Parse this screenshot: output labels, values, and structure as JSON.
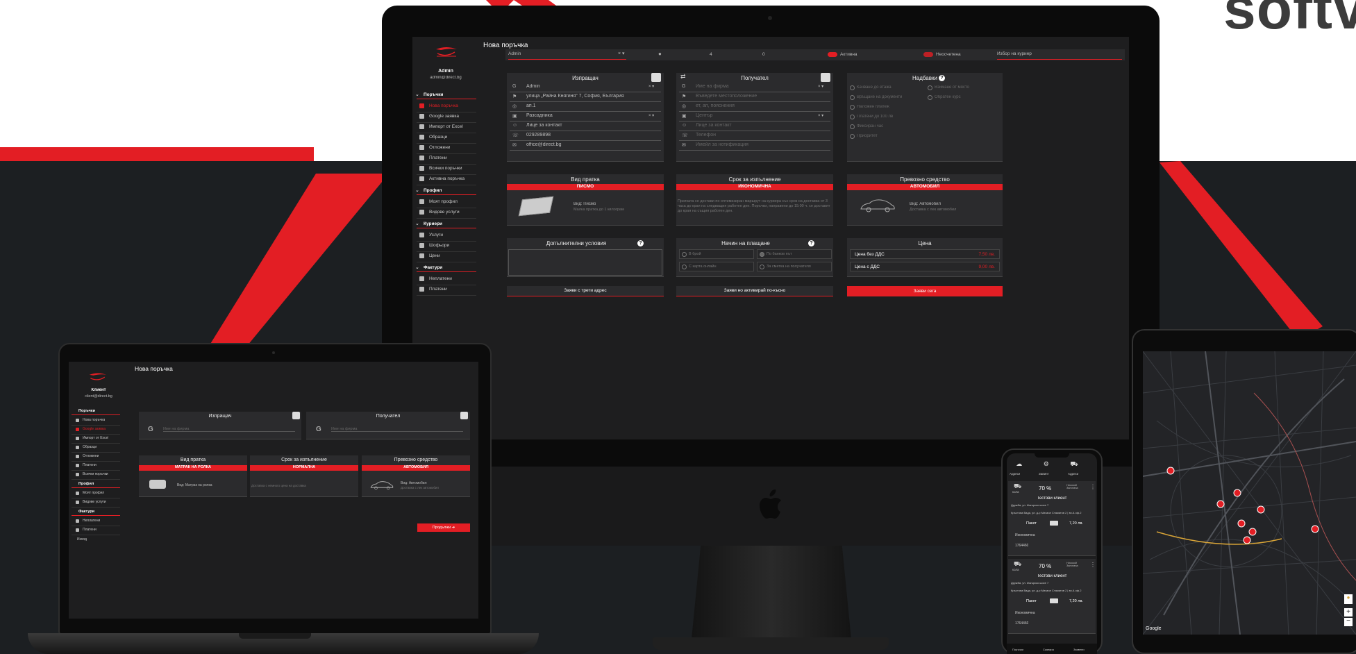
{
  "brand_text": "softv",
  "colors": {
    "accent": "#e31e24",
    "panel": "#1e1e1f",
    "card": "#2b2b2d",
    "dark_bg": "#1c1f22"
  },
  "monitor": {
    "page_title": "Нова поръчка",
    "user": {
      "name": "Admin",
      "email": "admin@direct.bg"
    },
    "nav": {
      "sections": [
        {
          "title": "Поръчки",
          "items": [
            "Нова поръчка",
            "Google заявка",
            "Импорт от Excel",
            "Образци",
            "Отложени",
            "Платени",
            "Всички поръчки",
            "Активна поръчка"
          ]
        },
        {
          "title": "Профил",
          "items": [
            "Моят профил",
            "Видове услуги"
          ]
        },
        {
          "title": "Куриери",
          "items": [
            "Услуги",
            "Шофьори",
            "Цени"
          ]
        },
        {
          "title": "Фактури",
          "items": [
            "Неплатени",
            "Платени"
          ]
        }
      ]
    },
    "topbar": {
      "client": "Admin",
      "count_a": "4",
      "count_b": "0",
      "toggle_active": "Активна",
      "toggle_unpaid": "Неосчетена",
      "courier_placeholder": "Избор на куриер"
    },
    "sender": {
      "title": "Изпращач",
      "badge": "адреси",
      "fields": [
        "Admin",
        "улица „Райна Княгиня“ 7, София, България",
        "ап.1",
        "Разсадника",
        "Лице за контакт",
        "029289898",
        "office@direct.bg"
      ]
    },
    "receiver": {
      "title": "Получател",
      "badge": "адреси",
      "fields": [
        "Име на фирма",
        "Въведете местоположение",
        "ет, ап, пояснения",
        "Център",
        "Лице за контакт",
        "Телефон",
        "Имейл за нотификация"
      ]
    },
    "surcharges": {
      "title": "Надбавки",
      "left": [
        "Качване до етажа",
        "Връщане на документи",
        "Наложен платеж",
        "Платени до 100 лв",
        "Фиксиран час",
        "Приоритет"
      ],
      "right": [
        "Взимане от място",
        "Обратен курс"
      ]
    },
    "shipment_type": {
      "title": "Вид пратка",
      "selected": "ПИСМО",
      "desc_title": "Вид: Писмо",
      "desc_sub": "Малка пратка до 1 килограм"
    },
    "deadline": {
      "title": "Срок за изпълнение",
      "selected": "ИКОНОМИЧНА",
      "desc": "Пратката се достави по оптимизиран маршрут на куриера със срок на доставка от 3 часа до края на следващия работен ден. Поръчки, направени до 15:00 ч. се доставят до края на същия работен ден."
    },
    "vehicle": {
      "title": "Превозно средство",
      "selected": "АВТОМОБИЛ",
      "desc_title": "Вид: Автомобил",
      "desc_sub": "Доставка с лек автомобил"
    },
    "extra": {
      "title": "Допълнителни условия"
    },
    "payment": {
      "title": "Начин на плащане",
      "options": [
        "В брой",
        "По банков път",
        "С карта онлайн",
        "За сметка на получателя"
      ]
    },
    "price": {
      "title": "Цена",
      "rows": [
        {
          "label": "Цена без ДДС",
          "value": "7,50 лв."
        },
        {
          "label": "Цена с ДДС",
          "value": "9,00 лв."
        }
      ]
    },
    "buttons": {
      "third_address": "Заяви с трети адрес",
      "not_active": "Заяви но активирай по-късно",
      "order_now": "Заяви сега"
    }
  },
  "laptop": {
    "page_title": "Нова поръчка",
    "user": {
      "name": "Клиент",
      "email": "client@direct.bg"
    },
    "nav": {
      "sections": [
        {
          "title": "Поръчки",
          "items": [
            "Нова поръчка",
            "Google заявка",
            "Импорт от Excel",
            "Образци",
            "Отложени",
            "Платени",
            "Всички поръчки"
          ]
        },
        {
          "title": "Профил",
          "items": [
            "Моят профил",
            "Видове услуги"
          ]
        },
        {
          "title": "Фактури",
          "items": [
            "Неплатени",
            "Платени"
          ]
        }
      ],
      "logout": "Изход"
    },
    "sender": {
      "title": "Изпращач",
      "badge": "адреси",
      "placeholder": "Име на фирма"
    },
    "receiver": {
      "title": "Получател",
      "badge": "адреси",
      "placeholder": "Име на фирма"
    },
    "shipment_type": {
      "title": "Вид пратка",
      "selected": "МАТРАК НА РОЛКА",
      "desc": "Вид: Матрак на ролка"
    },
    "deadline": {
      "title": "Срок за изпълнение",
      "selected": "НОРМАЛНА",
      "desc": "Доставка с немного цена на доставка"
    },
    "vehicle": {
      "title": "Превозно средство",
      "selected": "АВТОМОБИЛ",
      "desc_title": "Вид: Автомобил",
      "desc_sub": "Доставка с лек автомобил"
    },
    "continue_btn": "Продължи"
  },
  "phone": {
    "tabs": [
      "Адреси",
      "Завинт",
      "Адреси"
    ],
    "cards": [
      {
        "percent": "70 %",
        "vehicle": "кола",
        "tag": "Нисокой Запитана",
        "client": "Тестови клиент",
        "from": "Дружба, ул. Искърско шосе 7",
        "to": "Кръстова Вада, ул. д-р Михаил Стаматов 2 | вх.А оф.2",
        "type": "Пакет",
        "price": "7,20 лв.",
        "speed": "Икономична",
        "id": "1764460"
      },
      {
        "percent": "70 %",
        "vehicle": "кола",
        "tag": "Нисокой Запитана",
        "client": "Тестови клиент",
        "from": "Дружба, ул. Искърско шосе 7",
        "to": "Кръстова Вада, ул. д-р Михаил Стаматов 2 | вх.А оф.2",
        "type": "Пакет",
        "price": "7,20 лв.",
        "speed": "Икономична",
        "id": "1764460"
      }
    ],
    "bottom_nav": [
      "Поръчки",
      "Сканира",
      "Заявени"
    ]
  },
  "tablet": {
    "map_attribution": "Google"
  }
}
